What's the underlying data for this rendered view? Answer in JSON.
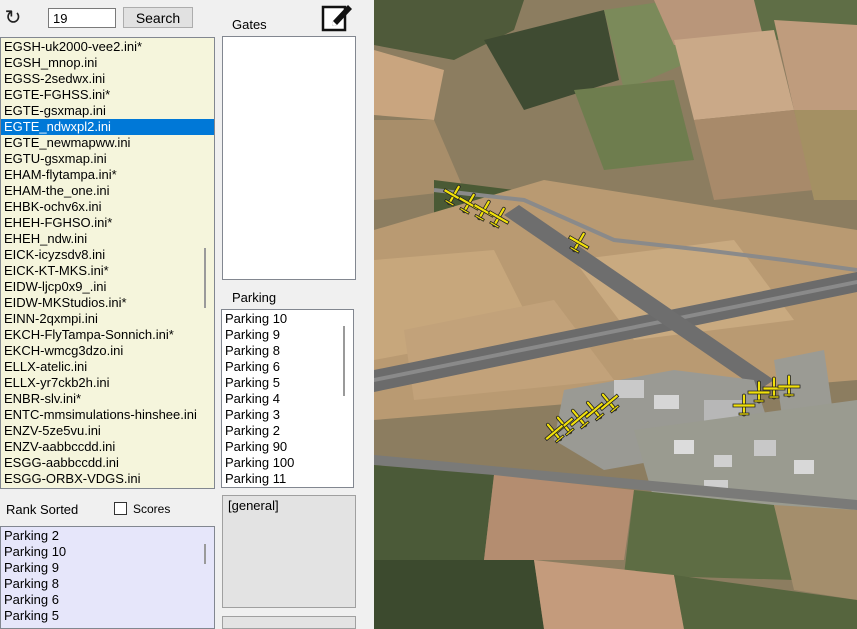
{
  "search": {
    "value": "19",
    "button_label": "Search"
  },
  "ini_files": [
    "EGSH-uk2000-vee2.ini*",
    "EGSH_mnop.ini",
    "EGSS-2sedwx.ini",
    "EGTE-FGHSS.ini*",
    "EGTE-gsxmap.ini",
    "EGTE_ndwxpl2.ini",
    "EGTE_newmapww.ini",
    "EGTU-gsxmap.ini",
    "EHAM-flytampa.ini*",
    "EHAM-the_one.ini",
    "EHBK-ochv6x.ini",
    "EHEH-FGHSO.ini*",
    "EHEH_ndw.ini",
    "EICK-icyzsdv8.ini",
    "EICK-KT-MKS.ini*",
    "EIDW-ljcp0x9_.ini",
    "EIDW-MKStudios.ini*",
    "EINN-2qxmpi.ini",
    "EKCH-FlyTampa-Sonnich.ini*",
    "EKCH-wmcg3dzo.ini",
    "ELLX-atelic.ini",
    "ELLX-yr7ckb2h.ini",
    "ENBR-slv.ini*",
    "ENTC-mmsimulations-hinshee.ini",
    "ENZV-5ze5vu.ini",
    "ENZV-aabbccdd.ini",
    "ESGG-aabbccdd.ini",
    "ESGG-ORBX-VDGS.ini"
  ],
  "selected_ini": "EGTE_ndwxpl2.ini",
  "gates": {
    "label": "Gates",
    "items": []
  },
  "parking": {
    "label": "Parking",
    "items": [
      "Parking 10",
      "Parking 9",
      "Parking 8",
      "Parking 6",
      "Parking 5",
      "Parking 4",
      "Parking 3",
      "Parking 2",
      "Parking 90",
      "Parking 100",
      "Parking 11"
    ]
  },
  "general_text": "[general]",
  "rank": {
    "label": "Rank Sorted",
    "scores_label": "Scores",
    "scores_checked": false,
    "items": [
      "Parking 2",
      "Parking 10",
      "Parking 9",
      "Parking 8",
      "Parking 6",
      "Parking 5"
    ]
  },
  "icons": {
    "refresh": "refresh-icon",
    "edit": "edit-icon",
    "aircraft": "aircraft-icon"
  },
  "colors": {
    "ini_bg": "#f5f5dc",
    "rank_bg": "#e6e6fa",
    "selection": "#0078d7",
    "aircraft": "#f2e10a"
  }
}
